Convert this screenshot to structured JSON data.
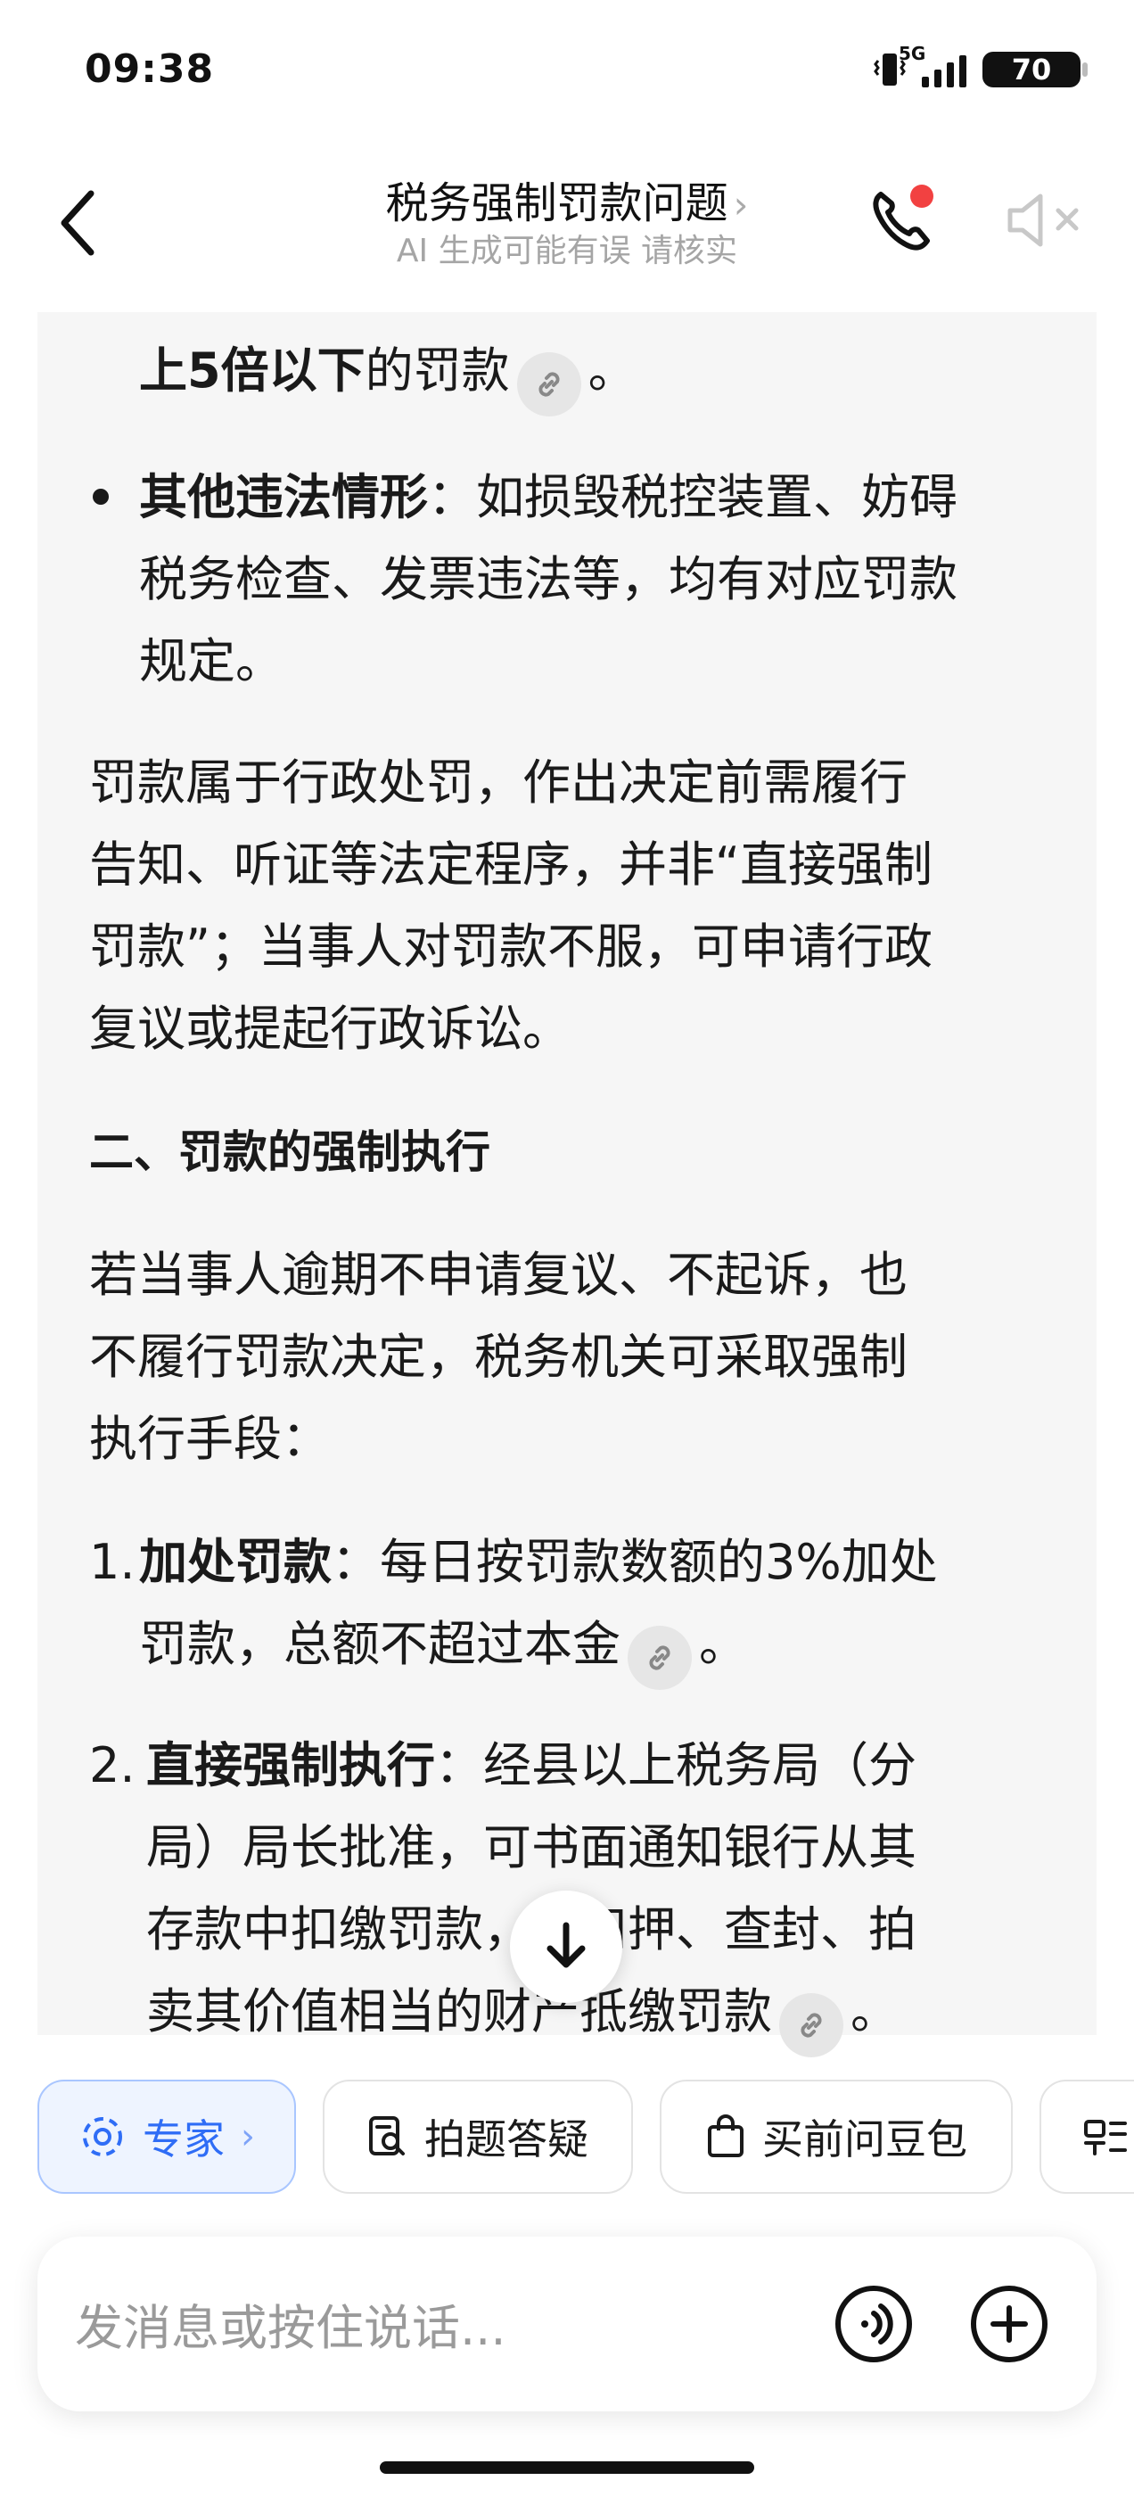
{
  "status_bar": {
    "time": "09:38",
    "network": "5G",
    "battery": "70"
  },
  "header": {
    "title": "税务强制罚款问题",
    "title_chevron": "›",
    "subtitle": "AI 生成可能有误 请核实"
  },
  "content": {
    "line_tail_bold": "上5倍以下",
    "line_tail_rest": "的罚款",
    "line_tail_end": "。",
    "bullet_title": "其他违法情形",
    "bullet_line1": "：如损毁税控装置、妨碍",
    "bullet_line2": "税务检查、发票违法等，均有对应罚款",
    "bullet_line3": "规定。",
    "para1_line1": "罚款属于行政处罚，作出决定前需履行",
    "para1_line2": "告知、听证等法定程序，并非“直接强制",
    "para1_line3": "罚款”；当事人对罚款不服，可申请行政",
    "para1_line4": "复议或提起行政诉讼。",
    "section_heading": "二、罚款的强制执行",
    "para2_line1": "若当事人逾期不申请复议、不起诉，也",
    "para2_line2": "不履行罚款决定，税务机关可采取强制",
    "para2_line3": "执行手段：",
    "item1_num": "1.",
    "item1_title": "加处罚款",
    "item1_line1": "：每日按罚款数额的3%加处",
    "item1_line2": "罚款，总额不超过本金",
    "item1_end": "。",
    "item2_num": "2.",
    "item2_title": "直接强制执行",
    "item2_line1": "：经县以上税务局（分",
    "item2_line2": "局）局长批准，可书面通知银行从其",
    "item2_line3": "存款中扣缴罚款，或扣押、查封、拍",
    "item2_line4": "卖其价值相当的财产抵缴罚款",
    "item2_end": "。"
  },
  "chips": {
    "expert": "专家",
    "expert_chevron": "›",
    "photo": "拍题答疑",
    "buy": "买前问豆包"
  },
  "input": {
    "placeholder": "发消息或按住说话..."
  },
  "colors": {
    "accent": "#2f6df6",
    "notification_dot": "#f24141",
    "bubble_bg": "#f6f6f6"
  },
  "icons": [
    "back-chevron-icon",
    "phone-icon",
    "mute-speaker-icon",
    "link-icon",
    "arrow-down-icon",
    "expert-icon",
    "photo-search-icon",
    "shopping-bag-icon",
    "voice-wave-icon",
    "plus-icon"
  ]
}
